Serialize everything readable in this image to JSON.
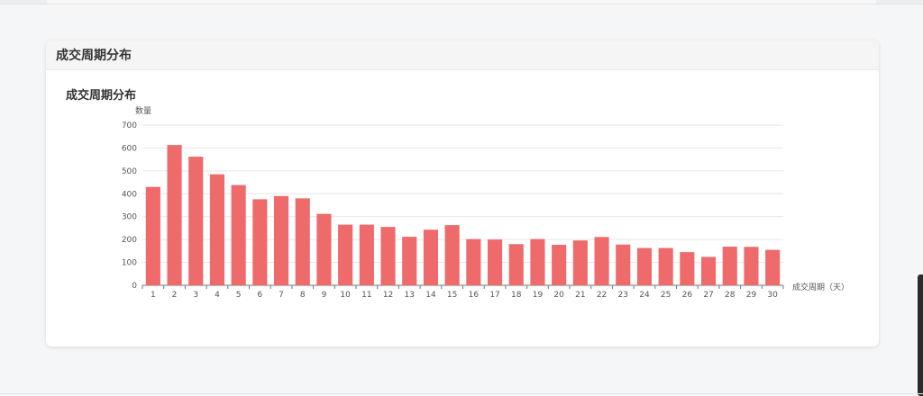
{
  "card": {
    "title": "成交周期分布"
  },
  "chart_data": {
    "type": "bar",
    "title": "成交周期分布",
    "ylabel": "数量",
    "xlabel": "成交周期（天）",
    "ylim": [
      0,
      700
    ],
    "yticks": [
      0,
      100,
      200,
      300,
      400,
      500,
      600,
      700
    ],
    "grid": true,
    "color": "#ee6a6b",
    "categories": [
      "1",
      "2",
      "3",
      "4",
      "5",
      "6",
      "7",
      "8",
      "9",
      "10",
      "11",
      "12",
      "13",
      "14",
      "15",
      "16",
      "17",
      "18",
      "19",
      "20",
      "21",
      "22",
      "23",
      "24",
      "25",
      "26",
      "27",
      "28",
      "29",
      "30"
    ],
    "values": [
      430,
      613,
      562,
      485,
      438,
      376,
      390,
      380,
      312,
      265,
      265,
      255,
      212,
      243,
      263,
      202,
      200,
      180,
      202,
      177,
      196,
      211,
      178,
      163,
      163,
      145,
      124,
      169,
      168,
      155
    ]
  }
}
